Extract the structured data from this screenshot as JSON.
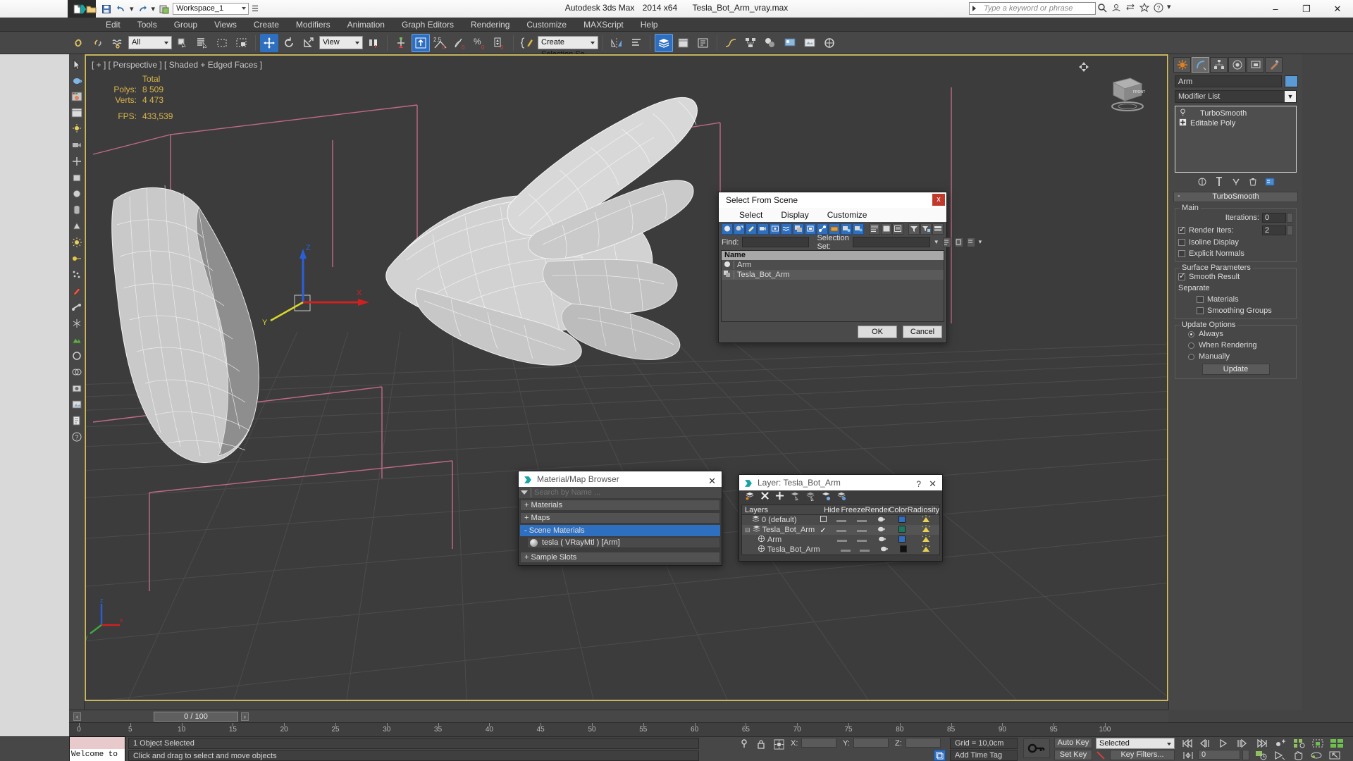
{
  "app": {
    "title_product": "Autodesk 3ds Max",
    "title_version": "2014 x64",
    "title_file": "Tesla_Bot_Arm_vray.max",
    "workspace": "Workspace_1",
    "search_placeholder": "Type a keyword or phrase",
    "accent_blue": "#2f6fc0",
    "viewport_border": "#c8b560"
  },
  "window_buttons": {
    "minimize": "–",
    "maximize": "❐",
    "close": "✕"
  },
  "menu": {
    "items": [
      "Edit",
      "Tools",
      "Group",
      "Views",
      "Create",
      "Modifiers",
      "Animation",
      "Graph Editors",
      "Rendering",
      "Customize",
      "MAXScript",
      "Help"
    ]
  },
  "toolbar": {
    "selection_filter": "All",
    "reference_coord": "View",
    "named_selection_set": "Create Selection Se",
    "snap_angle": "2.5",
    "snap_percent": "%"
  },
  "viewport": {
    "label": "[ + ] [ Perspective ] [ Shaded + Edged Faces ]",
    "stats_header": "Total",
    "stats": [
      {
        "label": "Polys:",
        "value": "8 509"
      },
      {
        "label": "Verts:",
        "value": "4 473"
      }
    ],
    "fps_label": "FPS:",
    "fps_value": "433,539",
    "viewcube_label": "FRONT",
    "axis_x": "X",
    "axis_y": "Y",
    "axis_z": "Z"
  },
  "select_from_scene": {
    "title": "Select From Scene",
    "close": "x",
    "menu": [
      "Select",
      "Display",
      "Customize"
    ],
    "find_label": "Find:",
    "find_value": "",
    "selection_set_label": "Selection Set:",
    "selection_set_value": "",
    "column_name": "Name",
    "rows": [
      {
        "name": "Arm",
        "icon": "sphere-icon",
        "selected": false
      },
      {
        "name": "Tesla_Bot_Arm",
        "icon": "group-icon",
        "selected": true
      }
    ],
    "ok": "OK",
    "cancel": "Cancel"
  },
  "material_browser": {
    "title": "Material/Map Browser",
    "close": "✕",
    "search_placeholder": "Search by Name ...",
    "groups": [
      {
        "label": "+ Materials",
        "selected": false
      },
      {
        "label": "+ Maps",
        "selected": false
      },
      {
        "label": "- Scene Materials",
        "selected": true
      }
    ],
    "items": [
      {
        "label": "tesla  ( VRayMtl )  [Arm]"
      }
    ],
    "footer_group": "+ Sample Slots"
  },
  "layer_dialog": {
    "title": "Layer: Tesla_Bot_Arm",
    "help": "?",
    "close": "✕",
    "columns": [
      "Layers",
      "",
      "Hide",
      "Freeze",
      "Render",
      "Color",
      "Radiosity"
    ],
    "rows": [
      {
        "name": "0 (default)",
        "indent": 1,
        "state": "box",
        "color": "#2f6fc0"
      },
      {
        "name": "Tesla_Bot_Arm",
        "indent": 0,
        "state": "check",
        "color": "#1a7a5e"
      },
      {
        "name": "Arm",
        "indent": 2,
        "state": "",
        "color": "#2f6fc0"
      },
      {
        "name": "Tesla_Bot_Arm",
        "indent": 2,
        "state": "",
        "color": "#111111"
      }
    ]
  },
  "command_panel": {
    "object_name": "Arm",
    "object_color": "#5b9bd5",
    "modifier_list": "Modifier List",
    "stack": [
      {
        "label": "TurboSmooth",
        "icon": "lightbulb-icon"
      },
      {
        "label": "Editable Poly",
        "icon": "plus-box-icon"
      }
    ],
    "rollout_title": "TurboSmooth",
    "rollout_minus": "-",
    "main_group": "Main",
    "iterations_label": "Iterations:",
    "iterations_value": "0",
    "render_iters_label": "Render Iters:",
    "render_iters_value": "2",
    "render_iters_checked": true,
    "isoline_display": "Isoline Display",
    "isoline_checked": false,
    "explicit_normals": "Explicit Normals",
    "explicit_checked": false,
    "surface_group": "Surface Parameters",
    "smooth_result": "Smooth Result",
    "smooth_checked": true,
    "separate_label": "Separate",
    "separate_materials": "Materials",
    "separate_materials_checked": false,
    "separate_smoothing": "Smoothing Groups",
    "separate_smoothing_checked": false,
    "update_group": "Update Options",
    "update_options": [
      {
        "label": "Always",
        "selected": true
      },
      {
        "label": "When Rendering",
        "selected": false
      },
      {
        "label": "Manually",
        "selected": false
      }
    ],
    "update_button": "Update"
  },
  "time_slider": {
    "current": "0 / 100",
    "prev": "‹",
    "next": "›",
    "ticks": [
      "0",
      "5",
      "10",
      "15",
      "20",
      "25",
      "30",
      "35",
      "40",
      "45",
      "50",
      "55",
      "60",
      "65",
      "70",
      "75",
      "80",
      "85",
      "90",
      "95",
      "100"
    ]
  },
  "status_bar": {
    "maxlogo_text": "Welcome to M",
    "selection_status": "1 Object Selected",
    "prompt": "Click and drag to select and move objects",
    "x_label": "X:",
    "x_value": "",
    "y_label": "Y:",
    "y_value": "",
    "z_label": "Z:",
    "z_value": "",
    "grid_text": "Grid = 10,0cm",
    "time_tag": "Add Time Tag",
    "auto_key": "Auto Key",
    "set_key": "Set Key",
    "key_mode": "Selected",
    "key_filters": "Key Filters...",
    "frame_value": "0"
  }
}
